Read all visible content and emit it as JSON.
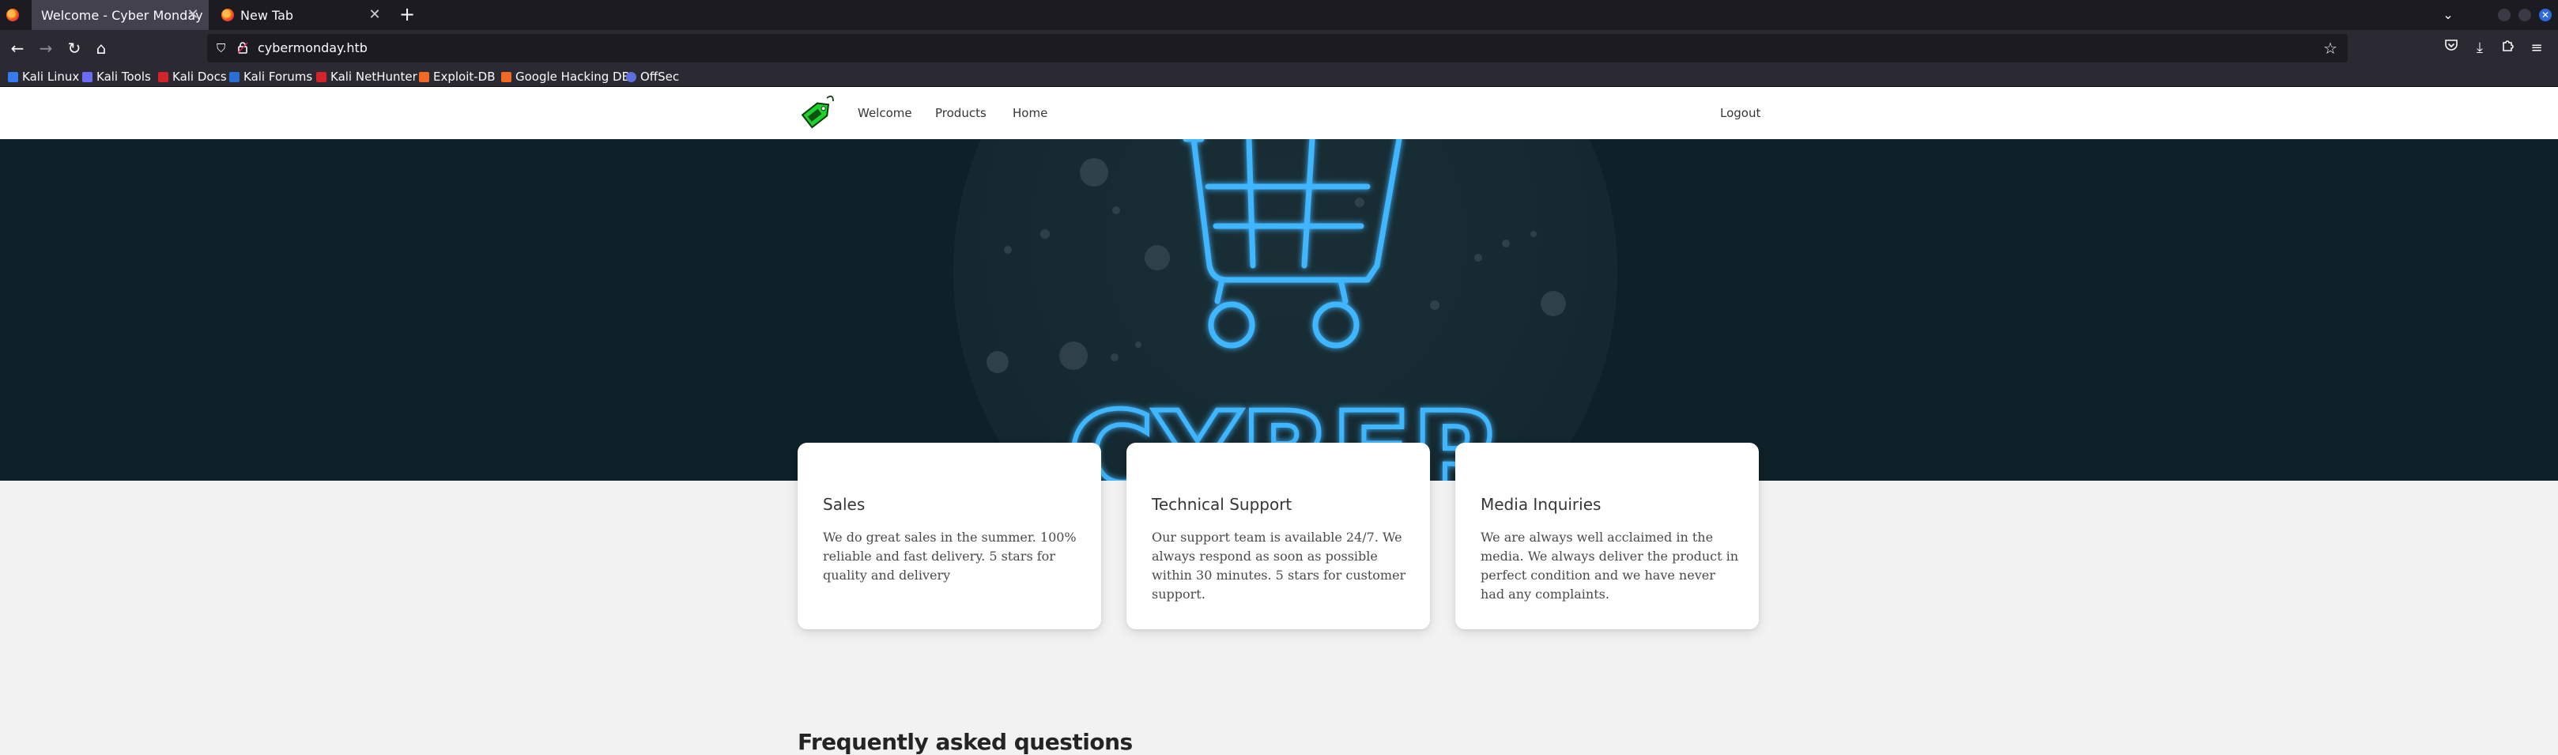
{
  "browser": {
    "tabs": [
      {
        "title": "Welcome - Cyber Monday",
        "active": true
      },
      {
        "title": "New Tab",
        "active": false
      }
    ],
    "new_tab_label": "+",
    "url": "cybermonday.htb",
    "bookmarks": [
      {
        "label": "Kali Linux",
        "color": "#367bf0"
      },
      {
        "label": "Kali Tools",
        "color": "#6b6cf6"
      },
      {
        "label": "Kali Docs",
        "color": "#d4232b"
      },
      {
        "label": "Kali Forums",
        "color": "#2a6fd6"
      },
      {
        "label": "Kali NetHunter",
        "color": "#d4232b"
      },
      {
        "label": "Exploit-DB",
        "color": "#f06a24"
      },
      {
        "label": "Google Hacking DB",
        "color": "#f06a24"
      },
      {
        "label": "OffSec",
        "color": "#5d6fdc"
      }
    ]
  },
  "site": {
    "nav": {
      "welcome": "Welcome",
      "products": "Products",
      "home": "Home",
      "logout": "Logout"
    },
    "cards": [
      {
        "title": "Sales",
        "body": "We do great sales in the summer. 100% reliable and fast delivery. 5 stars for quality and delivery"
      },
      {
        "title": "Technical Support",
        "body": "Our support team is available 24/7. We always respond as soon as possible within 30 minutes. 5 stars for customer support."
      },
      {
        "title": "Media Inquiries",
        "body": "We are always well acclaimed in the media. We always deliver the product in perfect condition and we have never had any complaints."
      }
    ],
    "faq_title": "Frequently asked questions",
    "hero_text": "CYBER",
    "colors": {
      "hero_bg": "#0e2128",
      "neon": "#3fb6ff",
      "logo_green": "#1fcf2c"
    }
  }
}
